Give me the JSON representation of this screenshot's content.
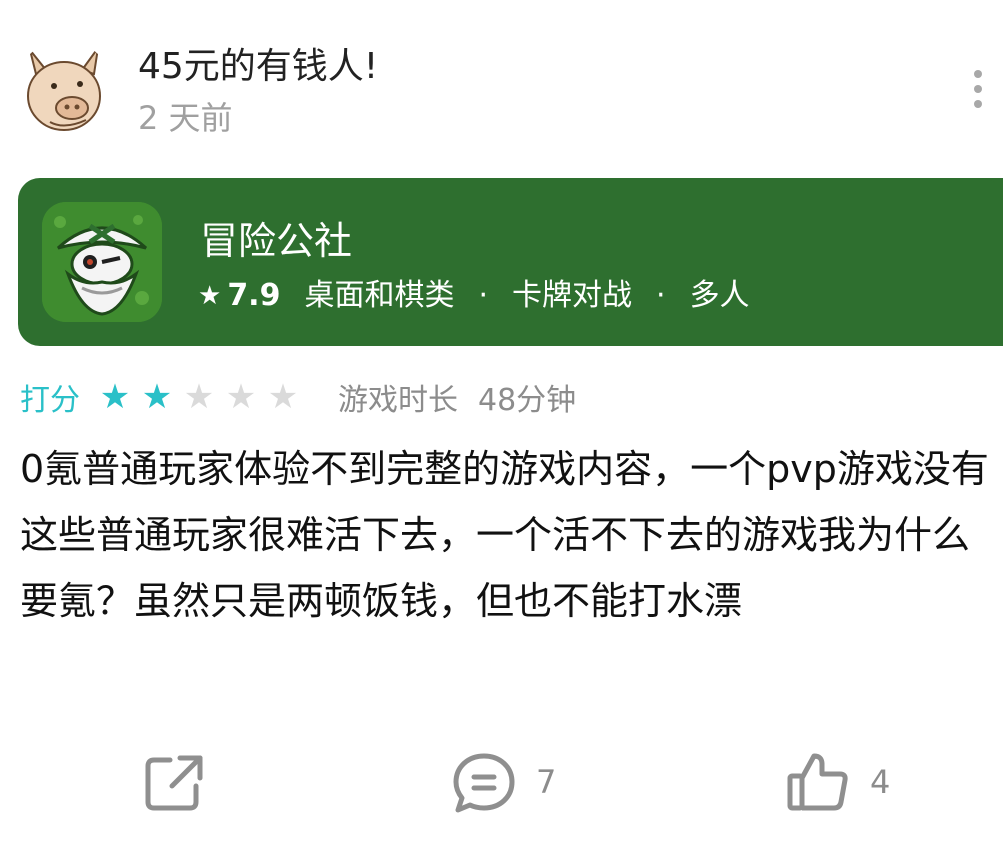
{
  "header": {
    "username": "45元的有钱人!",
    "timestamp": "2 天前"
  },
  "game": {
    "title": "冒险公社",
    "rating": "7.9",
    "tags": [
      "桌面和棋类",
      "卡牌对战",
      "多人"
    ],
    "tag_separator": "·"
  },
  "review": {
    "rating_label": "打分",
    "stars_filled": 2,
    "stars_total": 5,
    "playtime_label": "游戏时长",
    "playtime_value": "48分钟",
    "text": "0氪普通玩家体验不到完整的游戏内容，一个pvp游戏没有这些普通玩家很难活下去，一个活不下去的游戏我为什么要氪？虽然只是两顿饭钱，但也不能打水漂"
  },
  "actions": {
    "comment_count": "7",
    "like_count": "4"
  },
  "colors": {
    "card_bg": "#2e6f2f",
    "accent": "#2ac0c8",
    "muted": "#a0a0a0"
  },
  "icons": {
    "avatar": "pig-avatar",
    "game": "pirate-game-icon",
    "more": "more-vertical-icon",
    "share": "share-icon",
    "comment": "comment-icon",
    "like": "thumbs-up-icon"
  }
}
